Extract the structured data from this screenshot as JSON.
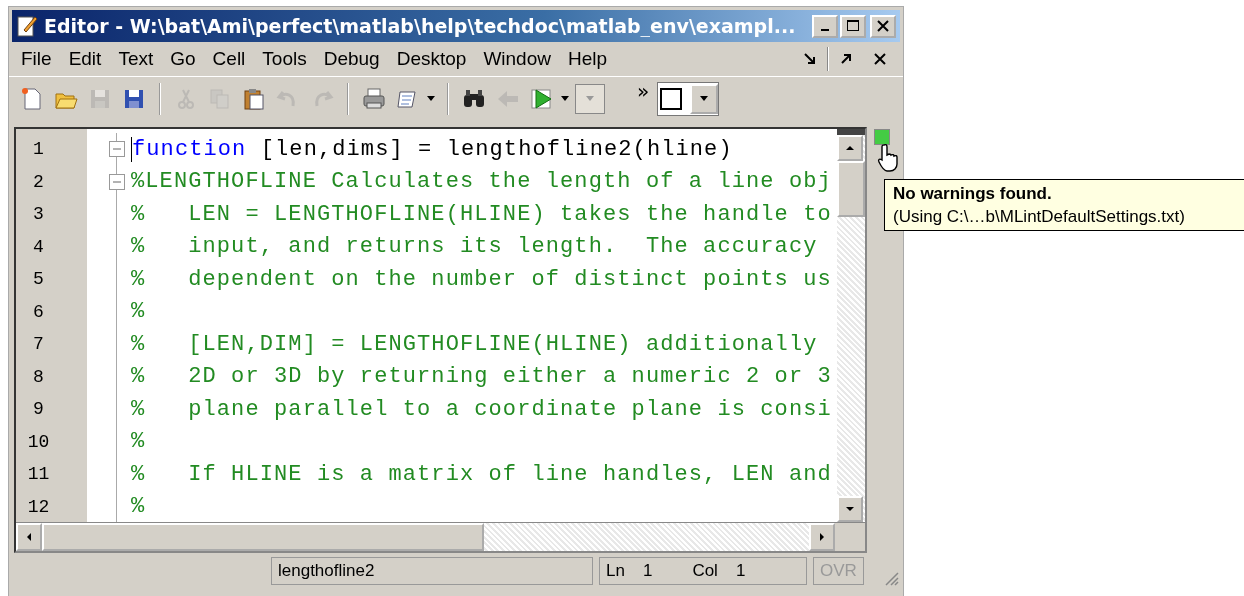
{
  "window": {
    "title": "Editor - W:\\bat\\Ami\\perfect\\matlab\\help\\techdoc\\matlab_env\\exampl..."
  },
  "menu": [
    {
      "label": "File"
    },
    {
      "label": "Edit"
    },
    {
      "label": "Text"
    },
    {
      "label": "Go"
    },
    {
      "label": "Cell"
    },
    {
      "label": "Tools"
    },
    {
      "label": "Debug"
    },
    {
      "label": "Desktop"
    },
    {
      "label": "Window"
    },
    {
      "label": "Help"
    }
  ],
  "toolbar": [
    {
      "kind": "new",
      "disabled": false
    },
    {
      "kind": "open",
      "disabled": false
    },
    {
      "kind": "save",
      "disabled": true
    },
    {
      "kind": "save-all",
      "disabled": false
    },
    {
      "kind": "separator"
    },
    {
      "kind": "cut",
      "disabled": true
    },
    {
      "kind": "copy",
      "disabled": true
    },
    {
      "kind": "paste",
      "disabled": false
    },
    {
      "kind": "undo",
      "disabled": true
    },
    {
      "kind": "redo",
      "disabled": true
    },
    {
      "kind": "separator"
    },
    {
      "kind": "print",
      "disabled": false
    },
    {
      "kind": "preview",
      "disabled": false
    },
    {
      "kind": "dropdown",
      "disabled": false
    },
    {
      "kind": "separator"
    },
    {
      "kind": "find",
      "disabled": false
    },
    {
      "kind": "back",
      "disabled": true
    },
    {
      "kind": "run",
      "disabled": false
    },
    {
      "kind": "dropdown",
      "disabled": false
    },
    {
      "kind": "combo",
      "disabled": true
    }
  ],
  "overflow": "»",
  "lines": [
    {
      "number": "1",
      "fold": true,
      "segments": [
        {
          "kind": "keyword",
          "text": "function"
        },
        {
          "kind": "plain",
          "text": " [len,dims] = lengthofline2(hline)"
        }
      ]
    },
    {
      "number": "2",
      "fold": true,
      "segments": [
        {
          "kind": "comment",
          "text": "%LENGTHOFLINE Calculates the length of a line obj"
        }
      ]
    },
    {
      "number": "3",
      "fold": false,
      "segments": [
        {
          "kind": "comment",
          "text": "%   LEN = LENGTHOFLINE(HLINE) takes the handle to"
        }
      ]
    },
    {
      "number": "4",
      "fold": false,
      "segments": [
        {
          "kind": "comment",
          "text": "%   input, and returns its length.  The accuracy"
        }
      ]
    },
    {
      "number": "5",
      "fold": false,
      "segments": [
        {
          "kind": "comment",
          "text": "%   dependent on the number of distinct points us"
        }
      ]
    },
    {
      "number": "6",
      "fold": false,
      "segments": [
        {
          "kind": "comment",
          "text": "%"
        }
      ]
    },
    {
      "number": "7",
      "fold": false,
      "segments": [
        {
          "kind": "comment",
          "text": "%   [LEN,DIM] = LENGTHOFLINE(HLINE) additionally"
        }
      ]
    },
    {
      "number": "8",
      "fold": false,
      "segments": [
        {
          "kind": "comment",
          "text": "%   2D or 3D by returning either a numeric 2 or 3"
        }
      ]
    },
    {
      "number": "9",
      "fold": false,
      "segments": [
        {
          "kind": "comment",
          "text": "%   plane parallel to a coordinate plane is consi"
        }
      ]
    },
    {
      "number": "10",
      "fold": false,
      "segments": [
        {
          "kind": "comment",
          "text": "%"
        }
      ]
    },
    {
      "number": "11",
      "fold": false,
      "segments": [
        {
          "kind": "comment",
          "text": "%   If HLINE is a matrix of line handles, LEN and"
        }
      ]
    },
    {
      "number": "12",
      "fold": false,
      "segments": [
        {
          "kind": "comment",
          "text": "%"
        }
      ]
    }
  ],
  "tooltip": {
    "title": "No warnings found.",
    "detail": "(Using C:\\…b\\MLintDefaultSettings.txt)"
  },
  "status_bar": {
    "function": "lengthofline2",
    "ln_label": "Ln",
    "ln": "1",
    "col_label": "Col",
    "col": "1",
    "ovr": {
      "label": "OVR",
      "disabled": true
    }
  }
}
